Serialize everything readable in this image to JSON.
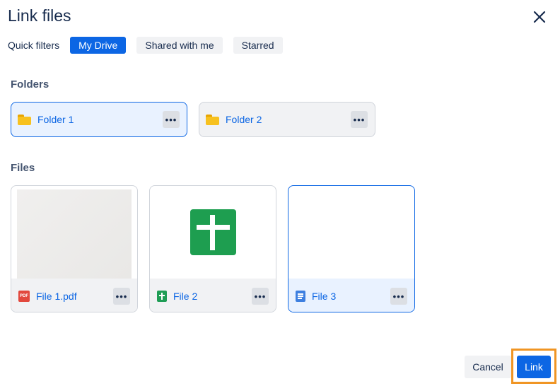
{
  "dialog": {
    "title": "Link files"
  },
  "filters": {
    "label": "Quick filters",
    "chips": [
      "My Drive",
      "Shared with me",
      "Starred"
    ],
    "active": "My Drive"
  },
  "folders_section": {
    "title": "Folders",
    "items": [
      {
        "name": "Folder 1",
        "selected": true,
        "icon": "folder-icon"
      },
      {
        "name": "Folder 2",
        "selected": false,
        "icon": "folder-icon"
      }
    ]
  },
  "files_section": {
    "title": "Files",
    "items": [
      {
        "name": "File 1.pdf",
        "type_icon": "pdf-icon",
        "type_icon_text": "PDF",
        "selected": false
      },
      {
        "name": "File 2",
        "type_icon": "sheets-icon",
        "selected": false
      },
      {
        "name": "File 3",
        "type_icon": "docs-icon",
        "selected": true
      }
    ]
  },
  "more_label": "•••",
  "actions": {
    "cancel": "Cancel",
    "link": "Link"
  },
  "colors": {
    "accent": "#0c66e4",
    "highlight": "#f09524",
    "sheets": "#1e9e50",
    "pdf": "#e2483d",
    "docs": "#3d7fe0",
    "folder": "#f7c11f"
  }
}
